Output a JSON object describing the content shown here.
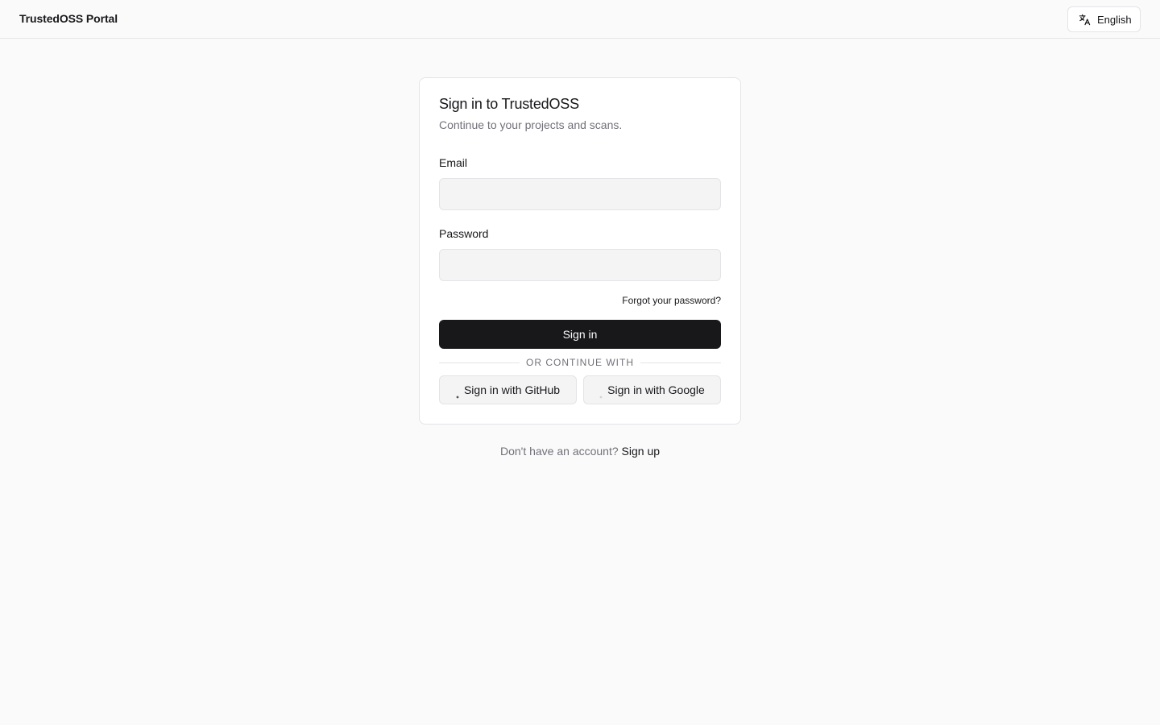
{
  "header": {
    "brand": "TrustedOSS Portal",
    "language": {
      "icon": "translate-icon",
      "label": "English"
    }
  },
  "card": {
    "title": "Sign in to TrustedOSS",
    "subtitle": "Continue to your projects and scans.",
    "email": {
      "label": "Email",
      "value": "",
      "placeholder": ""
    },
    "password": {
      "label": "Password",
      "value": "",
      "placeholder": ""
    },
    "forgot_label": "Forgot your password?",
    "submit_label": "Sign in",
    "divider_text": "OR CONTINUE WITH",
    "oauth": {
      "github": {
        "icon": "github-icon",
        "label": "Sign in with GitHub"
      },
      "google": {
        "icon": "google-icon",
        "label": "Sign in with Google"
      }
    }
  },
  "footer": {
    "prompt": "Don't have an account?",
    "signup_label": "Sign up"
  },
  "colors": {
    "background": "#fafafa",
    "primary": "#18181b",
    "muted_text": "#71717a",
    "border": "#e4e4e7",
    "input_bg": "#f4f4f5"
  }
}
